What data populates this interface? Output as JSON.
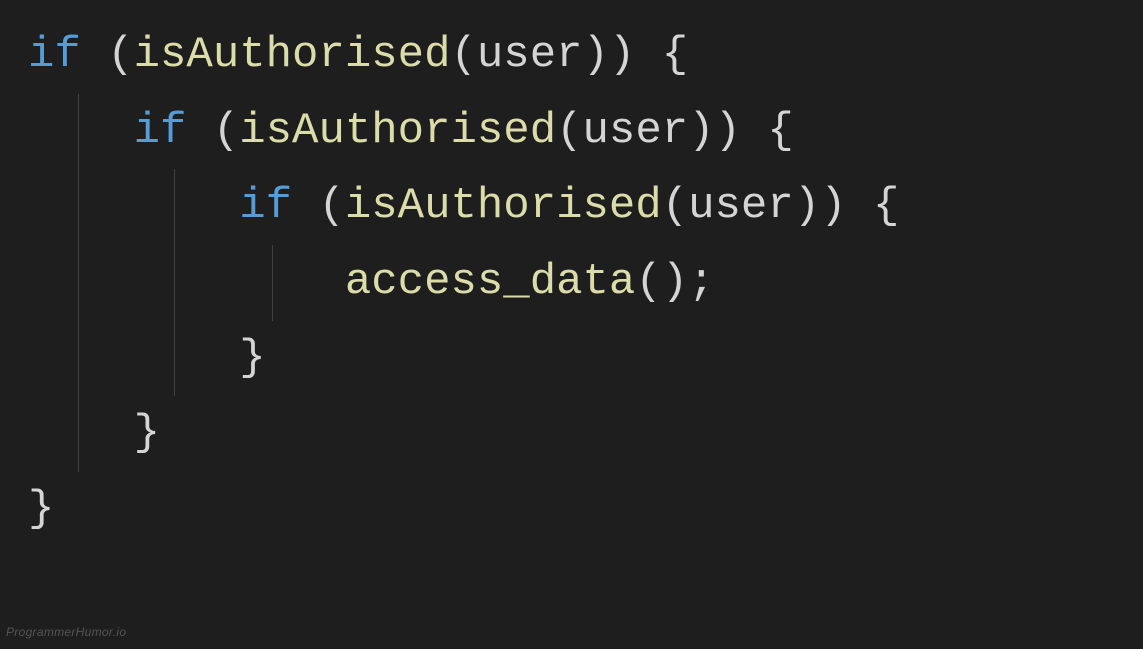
{
  "code": {
    "keyword": "if",
    "funcName": "isAuthorised",
    "paramName": "user",
    "innerCall": "access_data",
    "openParen": "(",
    "closeParen": ")",
    "openBrace": "{",
    "closeBrace": "}",
    "semicolon": ";",
    "emptyParens": "()"
  },
  "watermark": "ProgrammerHumor.io"
}
